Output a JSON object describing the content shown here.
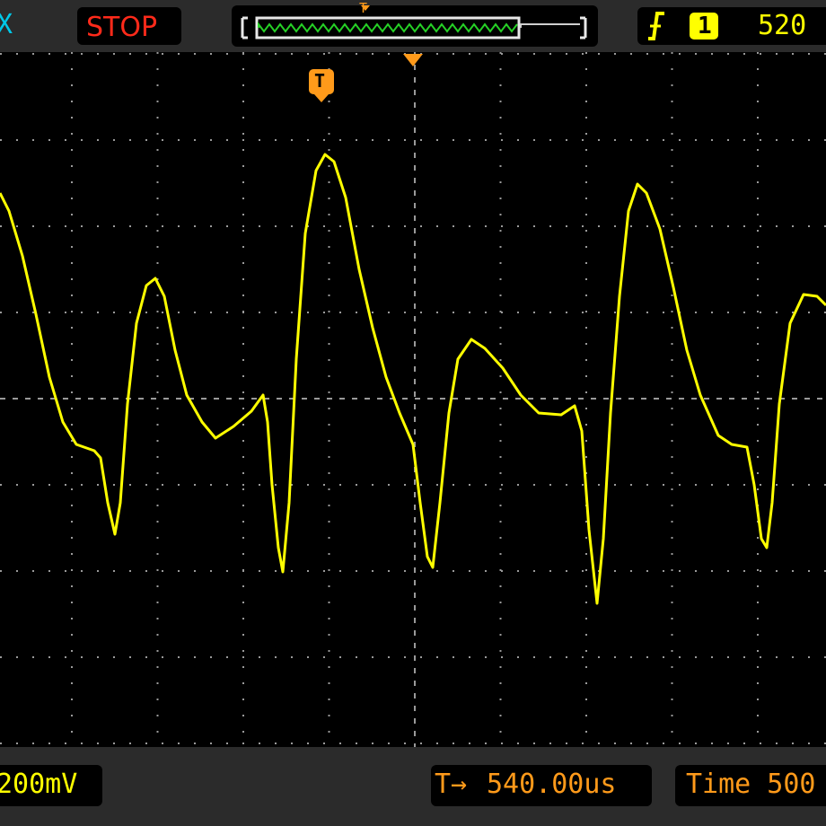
{
  "header": {
    "channel_partial": "X",
    "run_status": "STOP",
    "trigger_marker": "T",
    "trigger_edge_icon": "rising-edge-icon",
    "channel_number": "1",
    "trigger_level_partial": "520"
  },
  "screen": {
    "trigger_position_marker": "T",
    "trace_color": "#ffff00",
    "grid_color": "#9a9a9a"
  },
  "footer": {
    "channel_scale": "200mV",
    "trigger_offset_icon": "T→",
    "trigger_offset": "540.00us",
    "time_label_partial": "Time 500"
  },
  "colors": {
    "stop": "#ff2a1a",
    "cyan": "#00c8e8",
    "orange": "#ff9a1a",
    "yellow": "#ffff00",
    "green": "#26d026"
  },
  "trace": {
    "y_scale_per_div": "200mV",
    "points": [
      [
        0,
        215
      ],
      [
        10,
        235
      ],
      [
        25,
        285
      ],
      [
        40,
        350
      ],
      [
        55,
        420
      ],
      [
        70,
        470
      ],
      [
        85,
        495
      ],
      [
        105,
        502
      ],
      [
        112,
        510
      ],
      [
        120,
        560
      ],
      [
        128,
        595
      ],
      [
        134,
        560
      ],
      [
        142,
        450
      ],
      [
        152,
        360
      ],
      [
        163,
        318
      ],
      [
        173,
        310
      ],
      [
        183,
        330
      ],
      [
        195,
        390
      ],
      [
        208,
        440
      ],
      [
        225,
        470
      ],
      [
        240,
        488
      ],
      [
        260,
        475
      ],
      [
        280,
        458
      ],
      [
        293,
        440
      ],
      [
        298,
        470
      ],
      [
        303,
        540
      ],
      [
        310,
        610
      ],
      [
        315,
        637
      ],
      [
        322,
        560
      ],
      [
        330,
        400
      ],
      [
        340,
        260
      ],
      [
        352,
        190
      ],
      [
        362,
        172
      ],
      [
        372,
        180
      ],
      [
        385,
        220
      ],
      [
        400,
        300
      ],
      [
        415,
        365
      ],
      [
        430,
        420
      ],
      [
        445,
        460
      ],
      [
        460,
        495
      ],
      [
        468,
        560
      ],
      [
        476,
        620
      ],
      [
        482,
        632
      ],
      [
        490,
        560
      ],
      [
        500,
        460
      ],
      [
        510,
        400
      ],
      [
        525,
        378
      ],
      [
        540,
        388
      ],
      [
        560,
        410
      ],
      [
        580,
        440
      ],
      [
        600,
        460
      ],
      [
        625,
        462
      ],
      [
        640,
        452
      ],
      [
        648,
        480
      ],
      [
        656,
        590
      ],
      [
        665,
        672
      ],
      [
        672,
        600
      ],
      [
        680,
        460
      ],
      [
        690,
        330
      ],
      [
        700,
        235
      ],
      [
        710,
        205
      ],
      [
        720,
        215
      ],
      [
        735,
        255
      ],
      [
        750,
        320
      ],
      [
        765,
        390
      ],
      [
        780,
        440
      ],
      [
        800,
        485
      ],
      [
        815,
        495
      ],
      [
        832,
        498
      ],
      [
        840,
        540
      ],
      [
        848,
        600
      ],
      [
        854,
        610
      ],
      [
        860,
        560
      ],
      [
        868,
        450
      ],
      [
        880,
        360
      ],
      [
        895,
        328
      ],
      [
        910,
        330
      ],
      [
        920,
        340
      ]
    ]
  }
}
